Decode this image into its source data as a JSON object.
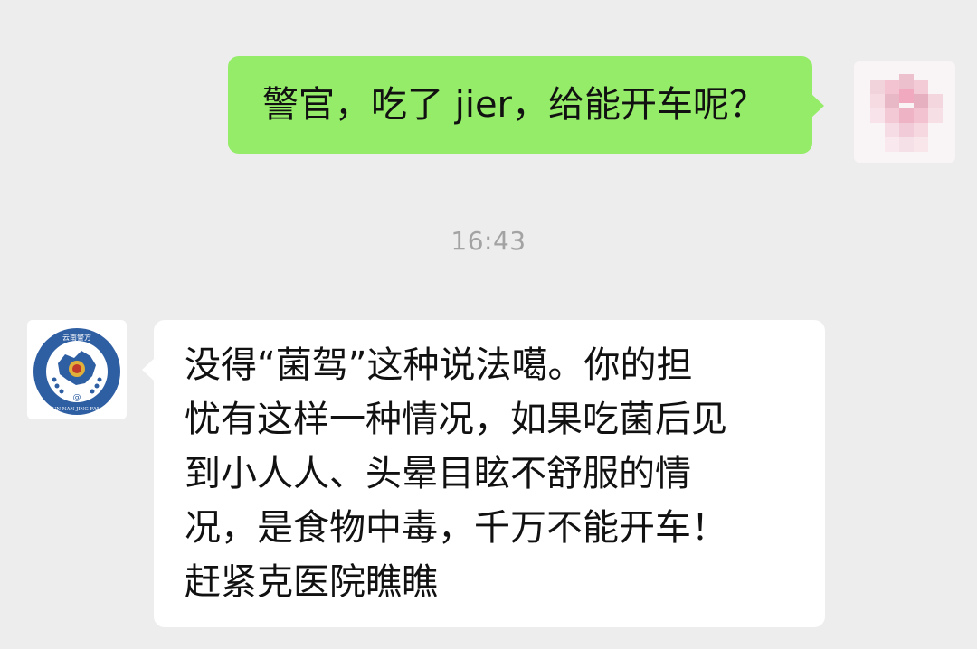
{
  "outgoing_message": {
    "text": "警官，吃了 jier，给能开车呢？"
  },
  "timestamp": "16:43",
  "incoming_message": {
    "lines": [
      "没得“菌驾”这种说法噶。你的担",
      "忧有这样一种情况，如果吃菌后见",
      "到小人人、头晕目眩不舒服的情",
      "况，是食物中毒，千万不能开车！",
      "赶紧克医院瞧瞧"
    ]
  },
  "sender_avatar": {
    "badge_top_text": "云南警方",
    "badge_bottom_text": "YUN NAN JING FANG"
  },
  "colors": {
    "background": "#ededed",
    "outgoing_bubble": "#95ec69",
    "incoming_bubble": "#ffffff",
    "badge_blue": "#2f5fa3",
    "timestamp": "#a3a3a3"
  },
  "icons": {
    "self_avatar": "pixelated-avatar-icon",
    "sender_avatar": "police-badge-icon"
  }
}
